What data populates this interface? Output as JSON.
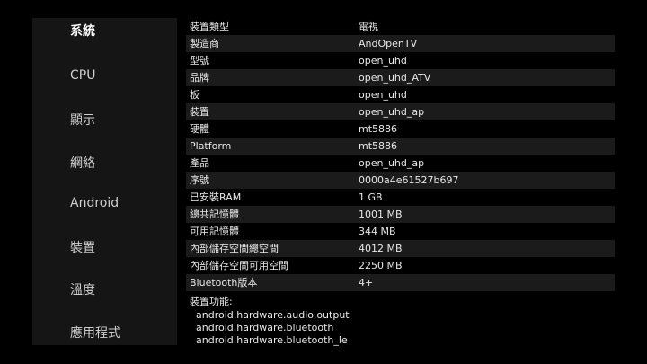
{
  "sidebar": {
    "items": [
      {
        "label": "系統",
        "active": true
      },
      {
        "label": "CPU"
      },
      {
        "label": "顯示"
      },
      {
        "label": "網絡"
      },
      {
        "label": "Android"
      },
      {
        "label": "裝置"
      },
      {
        "label": "溫度"
      },
      {
        "label": "應用程式"
      }
    ]
  },
  "info": {
    "rows": [
      {
        "key": "裝置類型",
        "value": "電視"
      },
      {
        "key": "製造商",
        "value": "AndOpenTV"
      },
      {
        "key": "型號",
        "value": "open_uhd"
      },
      {
        "key": "品牌",
        "value": "open_uhd_ATV"
      },
      {
        "key": "板",
        "value": "open_uhd"
      },
      {
        "key": "裝置",
        "value": "open_uhd_ap"
      },
      {
        "key": "硬體",
        "value": "mt5886"
      },
      {
        "key": "Platform",
        "value": "mt5886"
      },
      {
        "key": "產品",
        "value": "open_uhd_ap"
      },
      {
        "key": "序號",
        "value": "0000a4e61527b697"
      },
      {
        "key": "已安裝RAM",
        "value": "1 GB"
      },
      {
        "key": "總共記憶體",
        "value": "1001 MB"
      },
      {
        "key": "可用記憶體",
        "value": "344 MB"
      },
      {
        "key": "內部儲存空間總空間",
        "value": "4012 MB"
      },
      {
        "key": "內部儲存空間可用空間",
        "value": "2250 MB"
      },
      {
        "key": "Bluetooth版本",
        "value": "4+"
      }
    ],
    "features_title": "裝置功能:",
    "features": [
      "android.hardware.audio.output",
      "android.hardware.bluetooth",
      "android.hardware.bluetooth_le"
    ]
  }
}
